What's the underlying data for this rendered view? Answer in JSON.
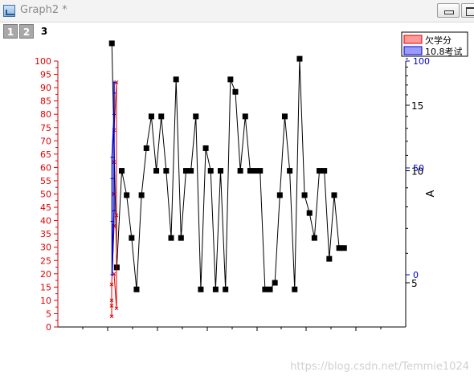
{
  "window": {
    "title": "Graph2 *"
  },
  "layers": [
    {
      "label": "1",
      "active": false
    },
    {
      "label": "2",
      "active": false
    },
    {
      "label": "3",
      "active": true
    }
  ],
  "watermark": "https://blog.csdn.net/Temmie1024",
  "colors": {
    "red": "#e00000",
    "blue": "#0000cc",
    "black": "#000000"
  },
  "chart_data": {
    "type": "line",
    "left_axis": {
      "color": "red",
      "range": [
        0,
        100
      ],
      "ticks": [
        "0",
        "5",
        "10",
        "15",
        "20",
        "25",
        "30",
        "35",
        "40",
        "45",
        "50",
        "55",
        "60",
        "65",
        "70",
        "75",
        "80",
        "85",
        "90",
        "95",
        "100"
      ]
    },
    "right_blue_axis": {
      "color": "blue",
      "range": [
        0,
        100
      ],
      "ticks": [
        {
          "label": "0",
          "value": 0
        },
        {
          "label": "50",
          "value": 50
        },
        {
          "label": "100",
          "value": 100
        }
      ]
    },
    "right_black_axis": {
      "label": "A",
      "ticks": [
        {
          "label": "5",
          "value": 5
        },
        {
          "label": "10",
          "value": 10
        },
        {
          "label": "15",
          "value": 15
        }
      ],
      "scale": "log"
    },
    "x_axis": {
      "tick_labels": []
    },
    "legend": {
      "position": "top-right",
      "entries": [
        {
          "label": "欠学分",
          "color": "red"
        },
        {
          "label": "10.8考试",
          "color": "blue"
        }
      ]
    },
    "series": [
      {
        "axis": "left",
        "color": "red",
        "markers": "x",
        "points": [
          [
            1,
            4
          ],
          [
            1,
            8
          ],
          [
            1,
            10
          ],
          [
            1,
            16
          ],
          [
            2,
            38
          ],
          [
            2,
            50
          ],
          [
            2,
            62
          ],
          [
            2,
            74
          ],
          [
            3,
            92
          ],
          [
            3,
            42
          ],
          [
            3,
            7
          ],
          [
            2,
            20
          ]
        ]
      },
      {
        "axis": "right_blue",
        "color": "blue",
        "markers": "cross",
        "points": [
          [
            1,
            0
          ],
          [
            1,
            25
          ],
          [
            1,
            45
          ],
          [
            1,
            55
          ],
          [
            2,
            75
          ],
          [
            2,
            85
          ],
          [
            2,
            90
          ],
          [
            2,
            30
          ],
          [
            1,
            0
          ]
        ]
      },
      {
        "axis": "right_black",
        "color": "black",
        "markers": "square",
        "values": [
          22,
          5.5,
          10,
          8.6,
          6.6,
          4.8,
          8.6,
          11.5,
          14,
          10,
          14,
          10,
          6.6,
          17.6,
          6.6,
          10,
          10,
          14,
          4.8,
          11.5,
          10,
          4.8,
          10,
          4.8,
          17.6,
          16.3,
          10,
          14,
          10,
          10,
          10,
          4.8,
          4.8,
          5,
          8.6,
          14,
          10,
          4.8,
          20,
          8.6,
          7.7,
          6.6,
          10,
          10,
          5.8,
          8.6,
          6.2,
          6.2
        ]
      }
    ]
  }
}
